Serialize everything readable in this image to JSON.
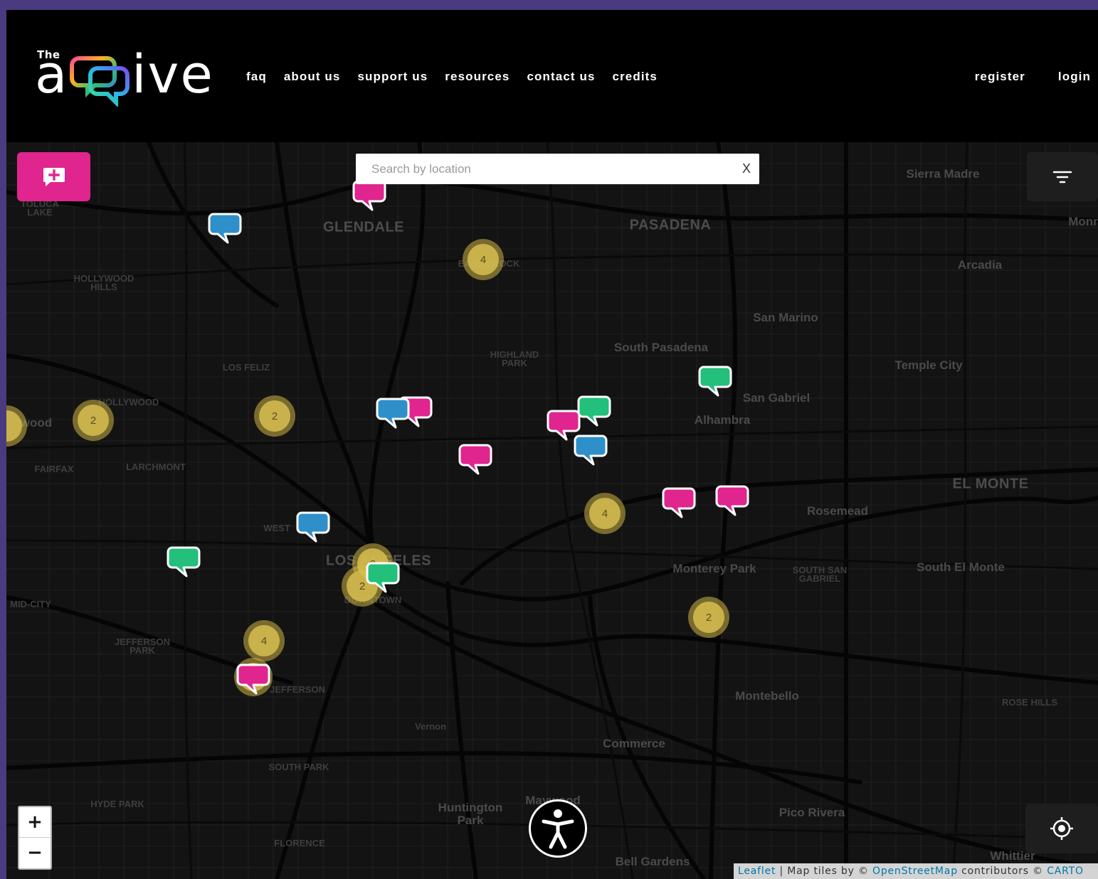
{
  "header": {
    "logo": {
      "small": "The",
      "left": "a",
      "right": "ive"
    },
    "nav": [
      "faq",
      "about us",
      "support us",
      "resources",
      "contact us",
      "credits"
    ],
    "auth": [
      "register",
      "login"
    ]
  },
  "search": {
    "placeholder": "Search by location",
    "clear_label": "X"
  },
  "zoom": {
    "in_label": "+",
    "out_label": "−"
  },
  "attribution": {
    "leaflet": "Leaflet",
    "sep": " | Map tiles by © ",
    "osm": "OpenStreetMap",
    "contrib": " contributors © ",
    "carto": "CARTO"
  },
  "places": [
    "Sierra Madre",
    "GLENDALE",
    "PASADENA",
    "Arcadia",
    "San Marino",
    "South Pasadena",
    "Temple City",
    "San Gabriel",
    "Alhambra",
    "EL MONTE",
    "Rosemead",
    "Monterey Park",
    "SOUTH SAN GABRIEL",
    "South El Monte",
    "LOS ANGELES",
    "Montebello",
    "ROSE HILLS",
    "Commerce",
    "Vernon",
    "Huntington Park",
    "Pico Rivera",
    "Bell Gardens",
    "Whittier",
    "HOLLYWOOD HILLS",
    "LOS FELIZ",
    "HIGHLAND PARK",
    "FAIRFAX",
    "LARCHMONT",
    "MID-CITY",
    "JEFFERSON PARK",
    "SOUTH PARK",
    "HYDE PARK",
    "FLORENCE",
    "TOLUCA LAKE",
    "HOLLYWOOD",
    "wood",
    "WEST",
    "JEFFERSON",
    "DOWNTOWN",
    "EAGLE ROCK",
    "Monr",
    "Maywood"
  ],
  "marker_colors": {
    "pink": "#e0258f",
    "blue": "#2f8fc9",
    "green": "#22c07a",
    "cluster": "#cdb446"
  },
  "markers": [
    {
      "color": "pink"
    },
    {
      "color": "blue"
    },
    {
      "color": "blue"
    },
    {
      "color": "pink"
    },
    {
      "color": "pink"
    },
    {
      "color": "pink"
    },
    {
      "color": "green"
    },
    {
      "color": "blue"
    },
    {
      "color": "green"
    },
    {
      "color": "pink"
    },
    {
      "color": "pink"
    },
    {
      "color": "blue"
    },
    {
      "color": "green"
    },
    {
      "color": "green"
    },
    {
      "color": "pink"
    }
  ],
  "clusters": [
    {
      "count": "4"
    },
    {
      "count": "2"
    },
    {
      "count": "2"
    },
    {
      "count": "4"
    },
    {
      "count": "2"
    },
    {
      "count": "2"
    },
    {
      "count": "4"
    },
    {
      "count": "2"
    },
    {
      "count": ""
    }
  ],
  "icons": {
    "add": "add-comment-icon",
    "filter": "filter-icon",
    "locate": "locate-icon",
    "accessibility": "accessibility-icon"
  }
}
